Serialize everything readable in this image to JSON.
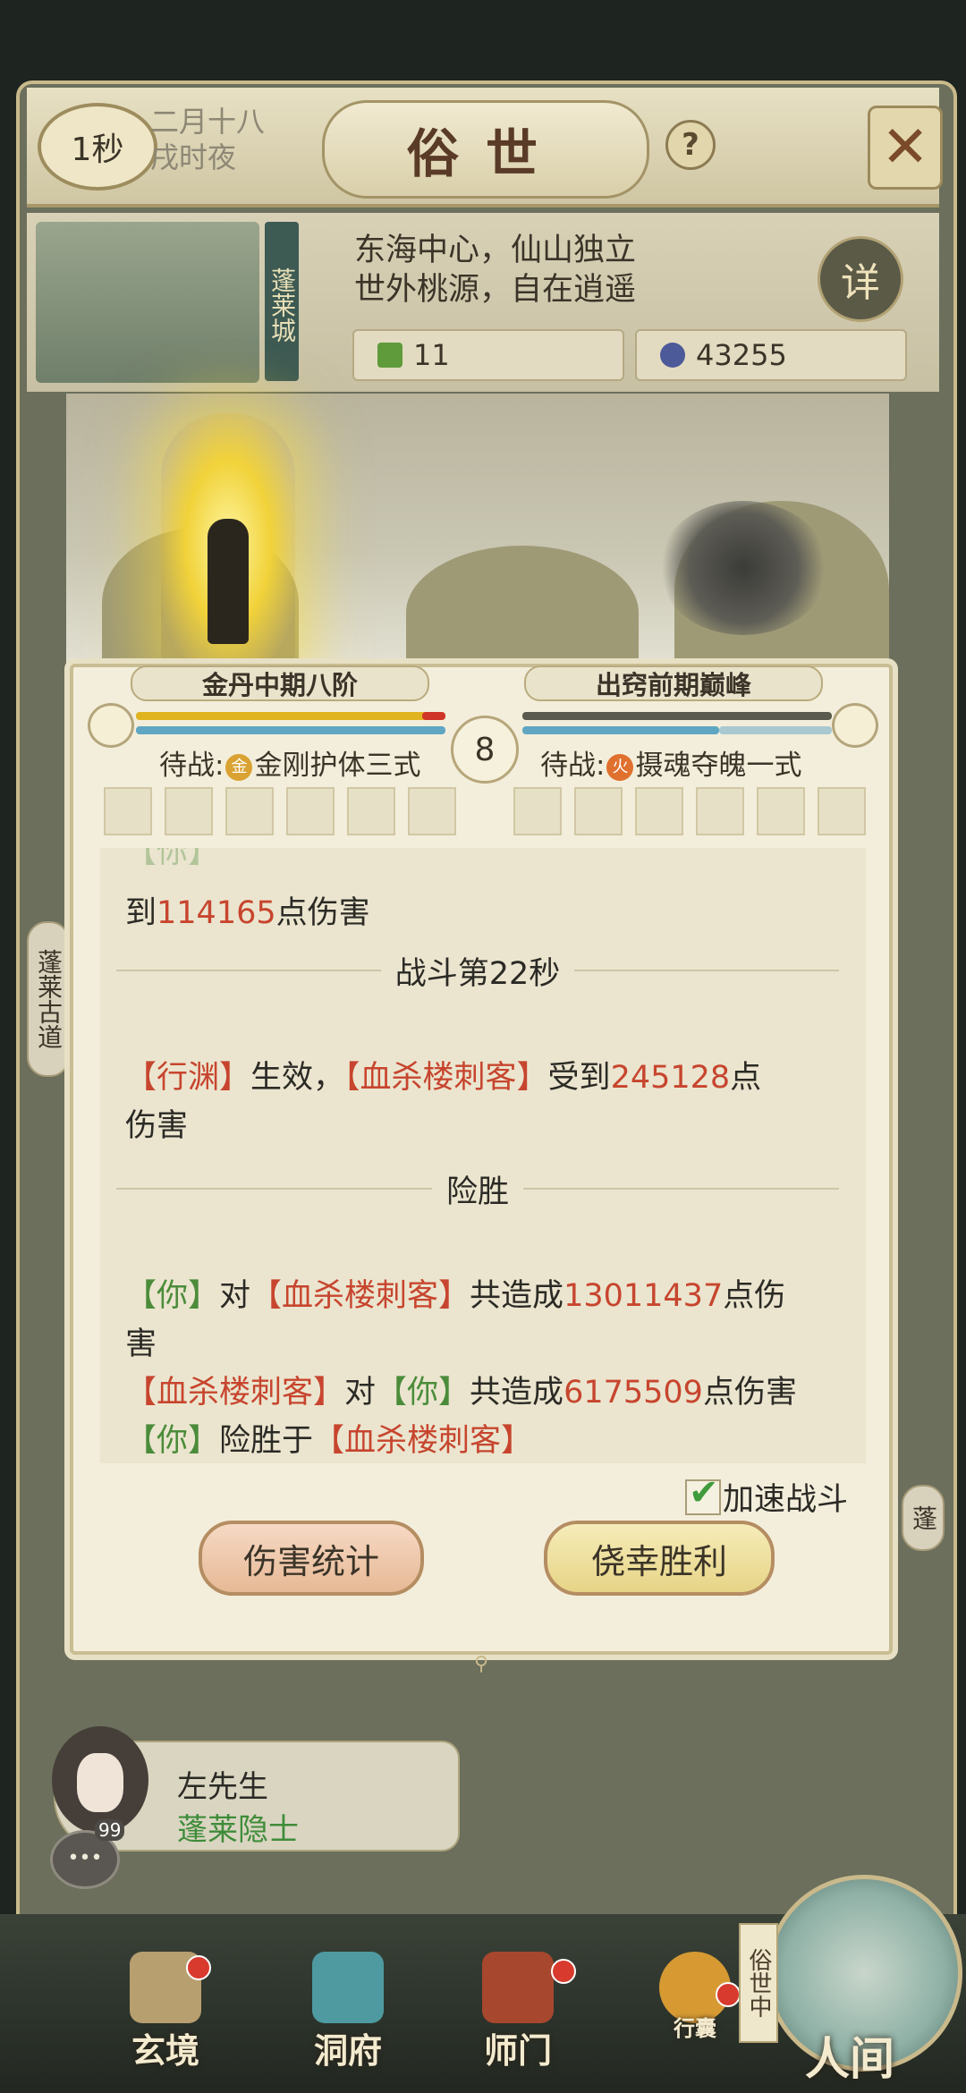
{
  "header": {
    "timer": "1秒",
    "date_line1": "二月十八",
    "date_line2": "戌时夜",
    "title": "俗世",
    "help_icon": "?"
  },
  "location": {
    "city_banner": "蓬莱城",
    "desc_line1": "东海中心，仙山独立",
    "desc_line2": "世外桃源，自在逍遥",
    "detail_label": "详",
    "resource1": "11",
    "resource2": "43255"
  },
  "battle": {
    "player_rank": "金丹中期八阶",
    "enemy_rank": "出窍前期巅峰",
    "round": "8",
    "player_hp_fraction": 1.0,
    "enemy_hp_fraction": 1.0,
    "player_stance_prefix": "待战:",
    "player_stance_element": "金",
    "player_stance_skill": "金刚护体三式",
    "enemy_stance_prefix": "待战:",
    "enemy_stance_element": "火",
    "enemy_stance_skill": "摄魂夺魄一式"
  },
  "log": {
    "line1_a": "到",
    "line1_num": "114165",
    "line1_b": "点伤害",
    "sep1": "战斗第22秒",
    "line2_a": "【行渊】",
    "line2_b": "生效，",
    "line2_c": "【血杀楼刺客】",
    "line2_d": "受到",
    "line2_num": "245128",
    "line2_e": "点",
    "line2_f": "伤害",
    "sep2": "险胜",
    "line3_a": "【你】",
    "line3_b": "对",
    "line3_c": "【血杀楼刺客】",
    "line3_d": "共造成",
    "line3_num": "13011437",
    "line3_e": "点伤",
    "line3_f": "害",
    "line4_a": "【血杀楼刺客】",
    "line4_b": "对",
    "line4_c": "【你】",
    "line4_d": "共造成",
    "line4_num": "6175509",
    "line4_e": "点伤害",
    "line5_a": "【你】",
    "line5_b": "险胜于",
    "line5_c": "【血杀楼刺客】"
  },
  "controls": {
    "speed_label": "加速战斗",
    "speed_checked": true,
    "stats_button": "伤害统计",
    "victory_button": "侥幸胜利"
  },
  "side": {
    "left_tag": "蓬莱古道",
    "right_tag": "蓬"
  },
  "npc": {
    "name": "左先生",
    "title": "蓬莱隐士",
    "chat_count": "99"
  },
  "nav": {
    "items": [
      "玄境",
      "洞府",
      "师门",
      "行囊"
    ],
    "world_tag": "俗世中",
    "world_label": "人间"
  },
  "colors": {
    "ally_green": "#4b8c3a",
    "enemy_red": "#c7452e"
  }
}
